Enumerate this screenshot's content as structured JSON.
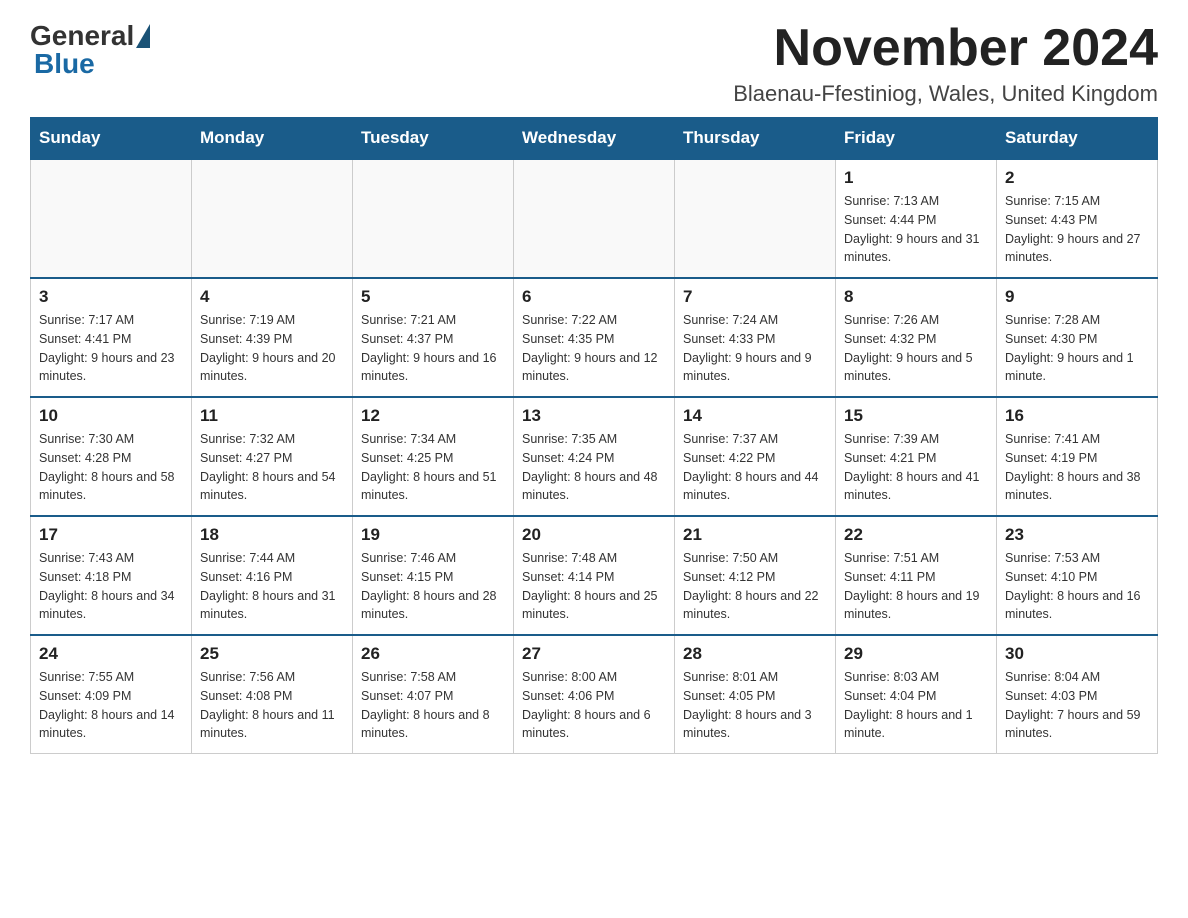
{
  "header": {
    "logo_general": "General",
    "logo_blue": "Blue",
    "month_title": "November 2024",
    "location": "Blaenau-Ffestiniog, Wales, United Kingdom"
  },
  "weekdays": [
    "Sunday",
    "Monday",
    "Tuesday",
    "Wednesday",
    "Thursday",
    "Friday",
    "Saturday"
  ],
  "weeks": [
    [
      {
        "day": "",
        "info": ""
      },
      {
        "day": "",
        "info": ""
      },
      {
        "day": "",
        "info": ""
      },
      {
        "day": "",
        "info": ""
      },
      {
        "day": "",
        "info": ""
      },
      {
        "day": "1",
        "info": "Sunrise: 7:13 AM\nSunset: 4:44 PM\nDaylight: 9 hours and 31 minutes."
      },
      {
        "day": "2",
        "info": "Sunrise: 7:15 AM\nSunset: 4:43 PM\nDaylight: 9 hours and 27 minutes."
      }
    ],
    [
      {
        "day": "3",
        "info": "Sunrise: 7:17 AM\nSunset: 4:41 PM\nDaylight: 9 hours and 23 minutes."
      },
      {
        "day": "4",
        "info": "Sunrise: 7:19 AM\nSunset: 4:39 PM\nDaylight: 9 hours and 20 minutes."
      },
      {
        "day": "5",
        "info": "Sunrise: 7:21 AM\nSunset: 4:37 PM\nDaylight: 9 hours and 16 minutes."
      },
      {
        "day": "6",
        "info": "Sunrise: 7:22 AM\nSunset: 4:35 PM\nDaylight: 9 hours and 12 minutes."
      },
      {
        "day": "7",
        "info": "Sunrise: 7:24 AM\nSunset: 4:33 PM\nDaylight: 9 hours and 9 minutes."
      },
      {
        "day": "8",
        "info": "Sunrise: 7:26 AM\nSunset: 4:32 PM\nDaylight: 9 hours and 5 minutes."
      },
      {
        "day": "9",
        "info": "Sunrise: 7:28 AM\nSunset: 4:30 PM\nDaylight: 9 hours and 1 minute."
      }
    ],
    [
      {
        "day": "10",
        "info": "Sunrise: 7:30 AM\nSunset: 4:28 PM\nDaylight: 8 hours and 58 minutes."
      },
      {
        "day": "11",
        "info": "Sunrise: 7:32 AM\nSunset: 4:27 PM\nDaylight: 8 hours and 54 minutes."
      },
      {
        "day": "12",
        "info": "Sunrise: 7:34 AM\nSunset: 4:25 PM\nDaylight: 8 hours and 51 minutes."
      },
      {
        "day": "13",
        "info": "Sunrise: 7:35 AM\nSunset: 4:24 PM\nDaylight: 8 hours and 48 minutes."
      },
      {
        "day": "14",
        "info": "Sunrise: 7:37 AM\nSunset: 4:22 PM\nDaylight: 8 hours and 44 minutes."
      },
      {
        "day": "15",
        "info": "Sunrise: 7:39 AM\nSunset: 4:21 PM\nDaylight: 8 hours and 41 minutes."
      },
      {
        "day": "16",
        "info": "Sunrise: 7:41 AM\nSunset: 4:19 PM\nDaylight: 8 hours and 38 minutes."
      }
    ],
    [
      {
        "day": "17",
        "info": "Sunrise: 7:43 AM\nSunset: 4:18 PM\nDaylight: 8 hours and 34 minutes."
      },
      {
        "day": "18",
        "info": "Sunrise: 7:44 AM\nSunset: 4:16 PM\nDaylight: 8 hours and 31 minutes."
      },
      {
        "day": "19",
        "info": "Sunrise: 7:46 AM\nSunset: 4:15 PM\nDaylight: 8 hours and 28 minutes."
      },
      {
        "day": "20",
        "info": "Sunrise: 7:48 AM\nSunset: 4:14 PM\nDaylight: 8 hours and 25 minutes."
      },
      {
        "day": "21",
        "info": "Sunrise: 7:50 AM\nSunset: 4:12 PM\nDaylight: 8 hours and 22 minutes."
      },
      {
        "day": "22",
        "info": "Sunrise: 7:51 AM\nSunset: 4:11 PM\nDaylight: 8 hours and 19 minutes."
      },
      {
        "day": "23",
        "info": "Sunrise: 7:53 AM\nSunset: 4:10 PM\nDaylight: 8 hours and 16 minutes."
      }
    ],
    [
      {
        "day": "24",
        "info": "Sunrise: 7:55 AM\nSunset: 4:09 PM\nDaylight: 8 hours and 14 minutes."
      },
      {
        "day": "25",
        "info": "Sunrise: 7:56 AM\nSunset: 4:08 PM\nDaylight: 8 hours and 11 minutes."
      },
      {
        "day": "26",
        "info": "Sunrise: 7:58 AM\nSunset: 4:07 PM\nDaylight: 8 hours and 8 minutes."
      },
      {
        "day": "27",
        "info": "Sunrise: 8:00 AM\nSunset: 4:06 PM\nDaylight: 8 hours and 6 minutes."
      },
      {
        "day": "28",
        "info": "Sunrise: 8:01 AM\nSunset: 4:05 PM\nDaylight: 8 hours and 3 minutes."
      },
      {
        "day": "29",
        "info": "Sunrise: 8:03 AM\nSunset: 4:04 PM\nDaylight: 8 hours and 1 minute."
      },
      {
        "day": "30",
        "info": "Sunrise: 8:04 AM\nSunset: 4:03 PM\nDaylight: 7 hours and 59 minutes."
      }
    ]
  ]
}
